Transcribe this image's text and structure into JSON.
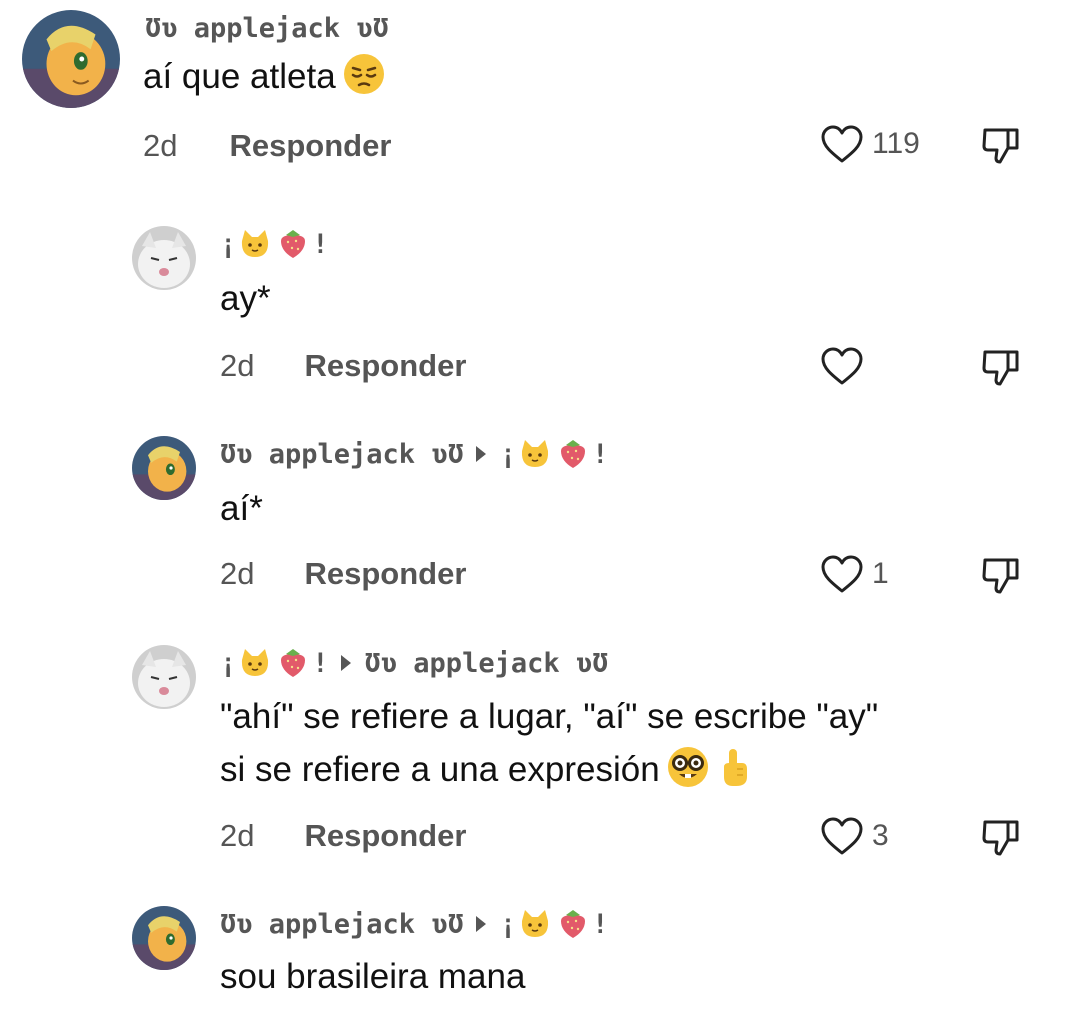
{
  "comments": [
    {
      "username": "Ʊʋ applejack ʋƱ",
      "text": "aí que atleta",
      "emoji": "pensive-face-emoji",
      "time": "2d",
      "reply_label": "Responder",
      "likes": "119"
    },
    {
      "username_parts": [
        "¡",
        "!"
      ],
      "username_emojis": [
        "cat-face-emoji",
        "strawberry-emoji"
      ],
      "text": "ay*",
      "time": "2d",
      "reply_label": "Responder",
      "likes": ""
    },
    {
      "username": "Ʊʋ applejack ʋƱ",
      "reply_to_parts": [
        "¡",
        "!"
      ],
      "reply_to_emojis": [
        "cat-face-emoji",
        "strawberry-emoji"
      ],
      "text": "aí*",
      "time": "2d",
      "reply_label": "Responder",
      "likes": "1"
    },
    {
      "username_parts": [
        "¡",
        "!"
      ],
      "username_emojis": [
        "cat-face-emoji",
        "strawberry-emoji"
      ],
      "reply_to": "Ʊʋ applejack ʋƱ",
      "text_lines": [
        "\"ahí\" se refiere a lugar, \"aí\" se escribe \"ay\"",
        "si se refiere a una expresión"
      ],
      "emojis": [
        "nerd-face-emoji",
        "pointing-up-emoji"
      ],
      "time": "2d",
      "reply_label": "Responder",
      "likes": "3"
    },
    {
      "username": "Ʊʋ applejack ʋƱ",
      "reply_to_parts": [
        "¡",
        "!"
      ],
      "reply_to_emojis": [
        "cat-face-emoji",
        "strawberry-emoji"
      ],
      "text": "sou brasileira mana"
    }
  ],
  "icons": {
    "like": "heart-outline-icon",
    "dislike": "thumbs-down-outline-icon"
  },
  "colors": {
    "text": "#111111",
    "secondary": "#555555",
    "username": "#565656",
    "background": "#ffffff"
  }
}
